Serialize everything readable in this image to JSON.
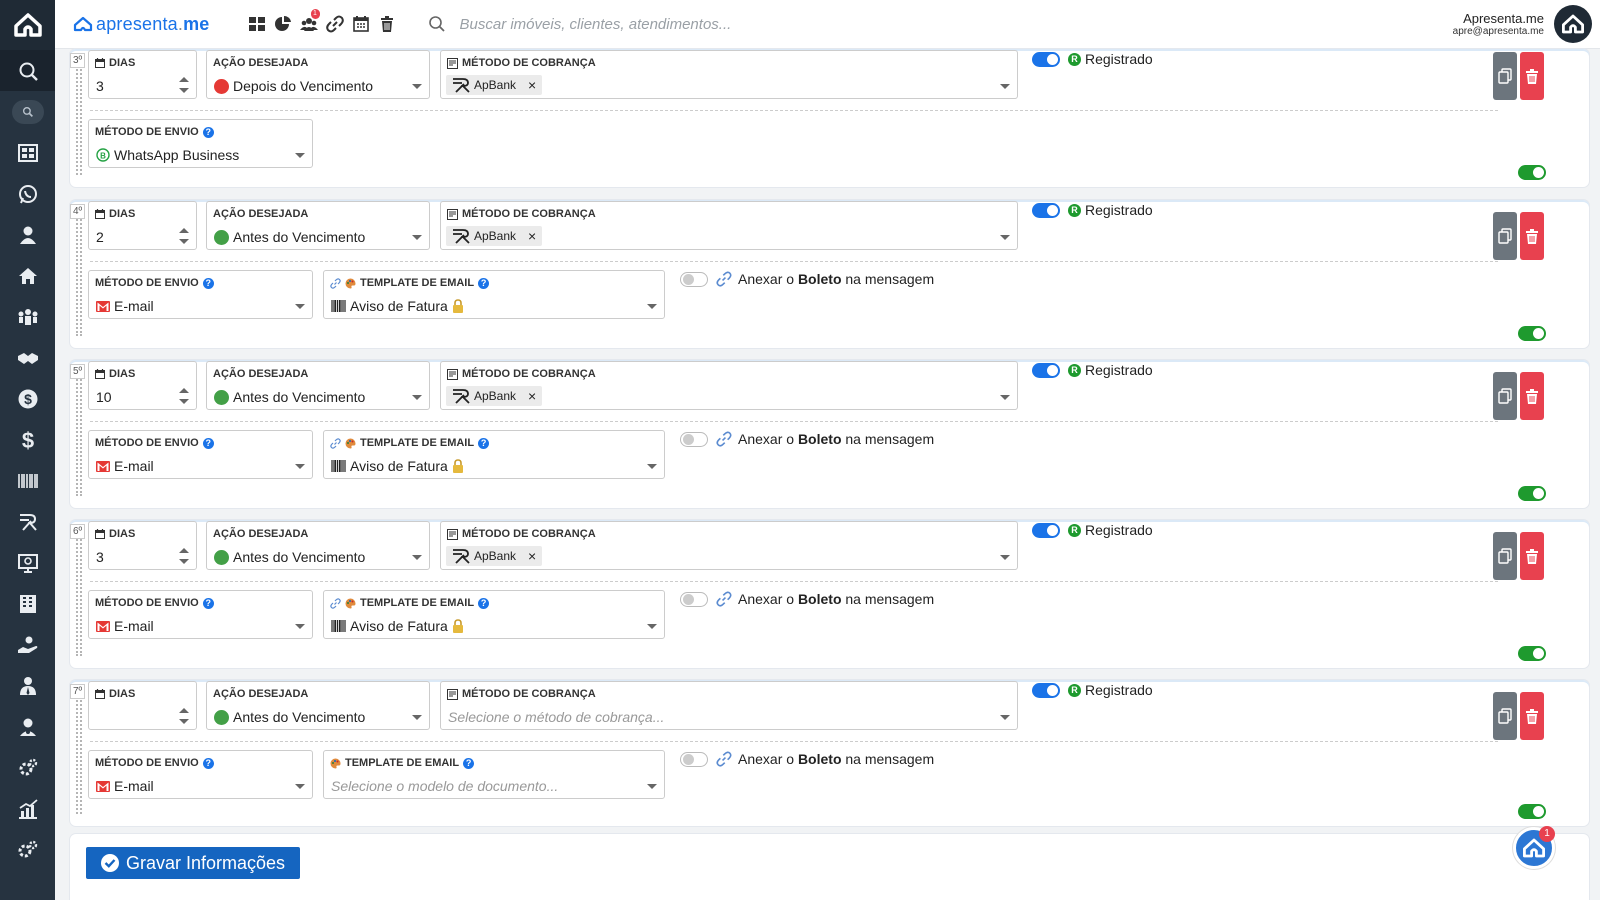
{
  "app": {
    "brand_a": "apresenta",
    "brand_b": "me",
    "search_placeholder": "Buscar imóveis, clientes, atendimentos...",
    "notification_badge": "1",
    "user_name": "Apresenta.me",
    "user_email": "apre@apresenta.me"
  },
  "sidebar": {
    "icons": [
      "home-logo-icon",
      "search-icon",
      "search-pill-icon",
      "dashboard-icon",
      "whatsapp-icon",
      "user-icon",
      "house-icon",
      "team-icon",
      "handshake-icon",
      "dollar-circle-icon",
      "dollar-icon",
      "barcode-icon",
      "apbank-icon",
      "screen-icon",
      "building-icon",
      "hand-user-icon",
      "user-tie-icon",
      "user-gear-icon",
      "gears-icon",
      "chart-icon",
      "settings-icon"
    ]
  },
  "labels": {
    "dias": "DIAS",
    "acao": "AÇÃO DESEJADA",
    "metodo_cobranca": "MÉTODO DE COBRANÇA",
    "metodo_envio": "MÉTODO DE ENVIO",
    "template_email": "TEMPLATE DE EMAIL",
    "registrado": "Registrado",
    "anexar_pre": "Anexar o ",
    "anexar_bold": "Boleto",
    "anexar_post": " na mensagem",
    "save": "Gravar Informações"
  },
  "rules": [
    {
      "ordinal": "3º",
      "dias": "3",
      "acao": "Depois do Vencimento",
      "acao_color": "#e53935",
      "cobranca_tag": "ApBank",
      "cobranca_placeholder": "",
      "envio": "WhatsApp Business",
      "envio_icon": "whatsapp-icon",
      "template": "",
      "template_placeholder": "",
      "has_template": false
    },
    {
      "ordinal": "4º",
      "dias": "2",
      "acao": "Antes do Vencimento",
      "acao_color": "#43a047",
      "cobranca_tag": "ApBank",
      "cobranca_placeholder": "",
      "envio": "E-mail",
      "envio_icon": "gmail-icon",
      "template": "Aviso de Fatura",
      "template_placeholder": "",
      "has_template": true
    },
    {
      "ordinal": "5º",
      "dias": "10",
      "acao": "Antes do Vencimento",
      "acao_color": "#43a047",
      "cobranca_tag": "ApBank",
      "cobranca_placeholder": "",
      "envio": "E-mail",
      "envio_icon": "gmail-icon",
      "template": "Aviso de Fatura",
      "template_placeholder": "",
      "has_template": true
    },
    {
      "ordinal": "6º",
      "dias": "3",
      "acao": "Antes do Vencimento",
      "acao_color": "#43a047",
      "cobranca_tag": "ApBank",
      "cobranca_placeholder": "",
      "envio": "E-mail",
      "envio_icon": "gmail-icon",
      "template": "Aviso de Fatura",
      "template_placeholder": "",
      "has_template": true
    },
    {
      "ordinal": "7º",
      "dias": "",
      "acao": "Antes do Vencimento",
      "acao_color": "#43a047",
      "cobranca_tag": "",
      "cobranca_placeholder": "Selecione o método de cobrança...",
      "envio": "E-mail",
      "envio_icon": "gmail-icon",
      "template": "",
      "template_placeholder": "Selecione o modelo de documento...",
      "has_template": true
    }
  ],
  "colors": {
    "primary": "#1a73e8",
    "danger": "#e8414f",
    "success": "#1e9a2e",
    "sidebar": "#263340"
  },
  "chat_badge": "1"
}
